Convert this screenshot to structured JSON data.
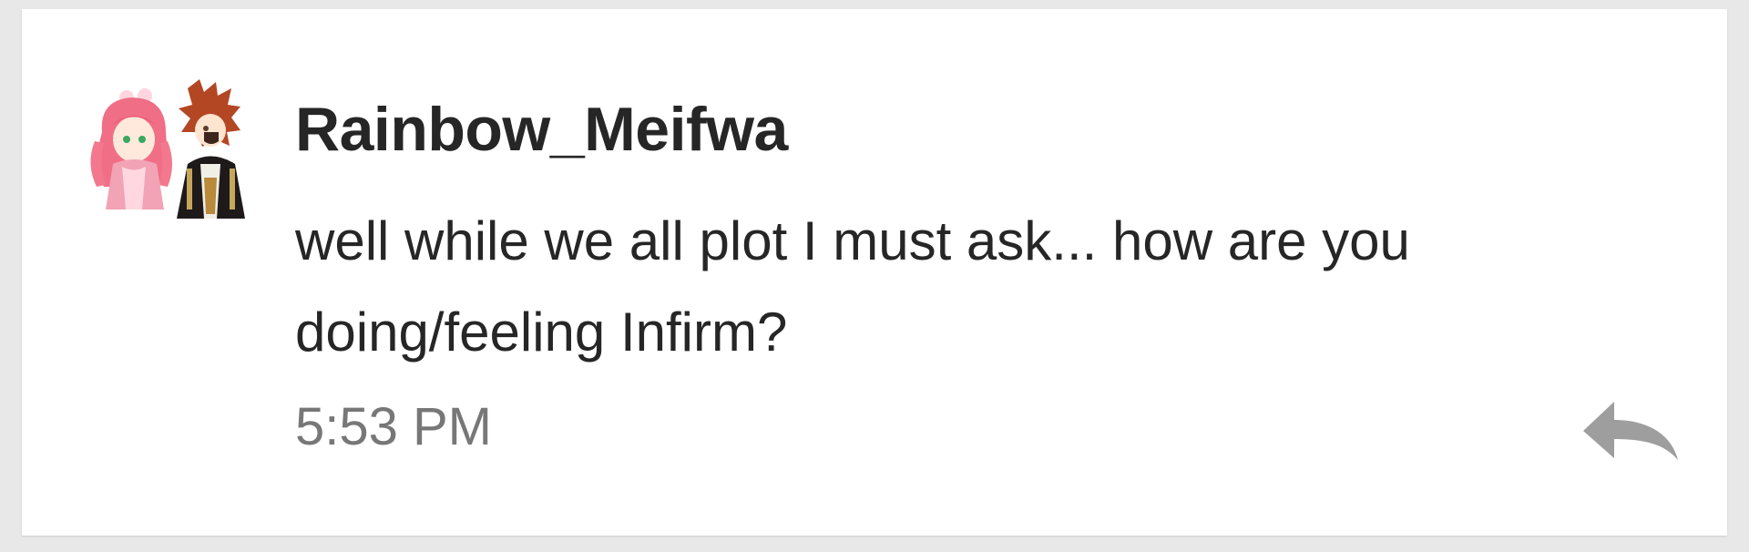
{
  "post": {
    "username": "Rainbow_Meifwa",
    "message": "well while we all plot I must ask... how are you doing/feeling Infirm?",
    "timestamp": "5:53 PM",
    "avatar_icon": "character-pair-avatar",
    "reply_icon": "reply-arrow-icon"
  },
  "colors": {
    "card": "#ffffff",
    "background": "#e8e8e8",
    "text": "#262626",
    "muted": "#777777",
    "reply_icon": "#9e9e9e"
  }
}
